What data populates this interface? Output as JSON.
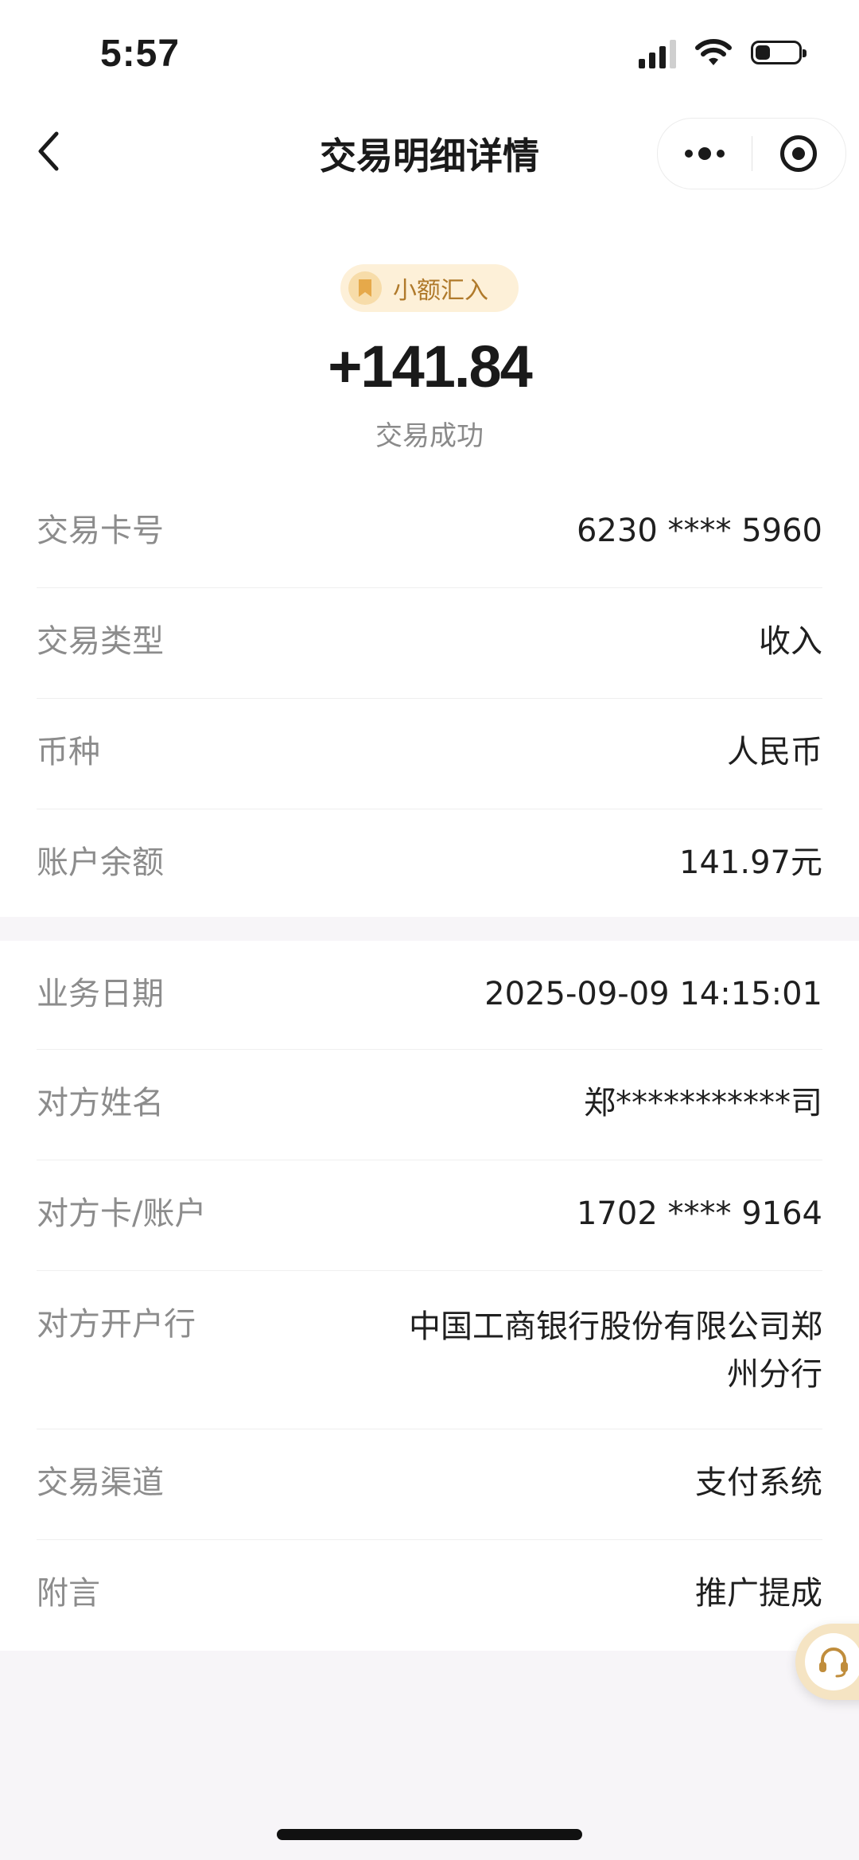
{
  "status_bar": {
    "time": "5:57",
    "battery_level": 0.35
  },
  "nav": {
    "title": "交易明细详情"
  },
  "summary": {
    "tag": "小额汇入",
    "amount": "+141.84",
    "status": "交易成功"
  },
  "details_primary": [
    {
      "label": "交易卡号",
      "value": "6230 **** 5960"
    },
    {
      "label": "交易类型",
      "value": "收入"
    },
    {
      "label": "币种",
      "value": "人民币"
    },
    {
      "label": "账户余额",
      "value": "141.97元"
    }
  ],
  "details_secondary": [
    {
      "label": "业务日期",
      "value": "2025-09-09 14:15:01"
    },
    {
      "label": "对方姓名",
      "value": "郑***********司"
    },
    {
      "label": "对方卡/账户",
      "value": "1702 **** 9164"
    },
    {
      "label": "对方开户行",
      "value": "中国工商银行股份有限公司郑州分行"
    },
    {
      "label": "交易渠道",
      "value": "支付系统"
    },
    {
      "label": "附言",
      "value": "推广提成"
    }
  ],
  "colors": {
    "accent_gold": "#b07a2b",
    "tag_bg": "#fdf0d8",
    "label_gray": "#8c8c8c"
  },
  "icons": {
    "back": "chevron-left-icon",
    "more": "more-dots-icon",
    "close": "target-close-icon",
    "tag": "bookmark-icon",
    "service": "headset-icon"
  }
}
